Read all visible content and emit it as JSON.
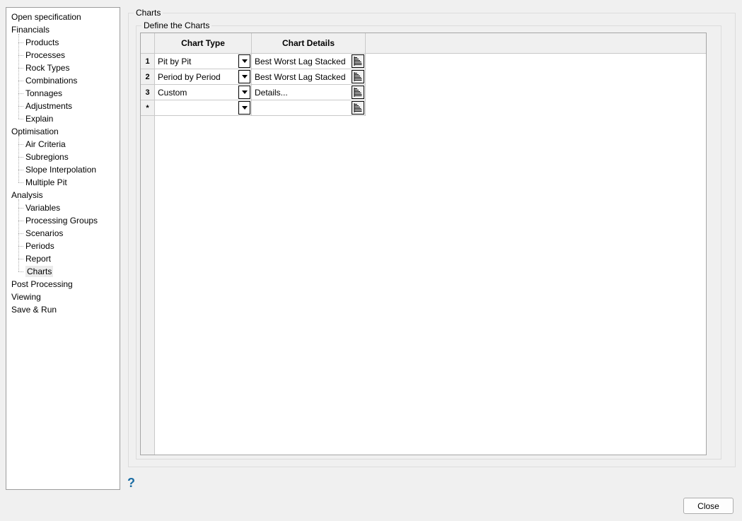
{
  "sidebar": {
    "selected": "Charts",
    "items": [
      {
        "label": "Open specification",
        "children": []
      },
      {
        "label": "Financials",
        "children": [
          "Products",
          "Processes",
          "Rock Types",
          "Combinations",
          "Tonnages",
          "Adjustments",
          "Explain"
        ]
      },
      {
        "label": "Optimisation",
        "children": [
          "Air Criteria",
          "Subregions",
          "Slope Interpolation",
          "Multiple Pit"
        ]
      },
      {
        "label": "Analysis",
        "children": [
          "Variables",
          "Processing Groups",
          "Scenarios",
          "Periods",
          "Report",
          "Charts"
        ]
      },
      {
        "label": "Post Processing",
        "children": []
      },
      {
        "label": "Viewing",
        "children": []
      },
      {
        "label": "Save & Run",
        "children": []
      }
    ]
  },
  "main": {
    "group_title": "Charts",
    "inner_group_title": "Define the Charts",
    "table": {
      "columns": [
        "",
        "Chart Type",
        "Chart Details"
      ],
      "rows": [
        {
          "num": "1",
          "chart_type": "Pit by Pit",
          "chart_details": "Best Worst Lag Stacked"
        },
        {
          "num": "2",
          "chart_type": "Period by Period",
          "chart_details": "Best Worst Lag Stacked"
        },
        {
          "num": "3",
          "chart_type": "Custom",
          "chart_details": "Details..."
        },
        {
          "num": "*",
          "chart_type": "",
          "chart_details": ""
        }
      ]
    }
  },
  "help": {
    "label": "?"
  },
  "footer": {
    "close_label": "Close"
  },
  "icons": {
    "dropdown-arrow-icon": "black down triangle",
    "chart-details-icon": "horizontal bar-lines glyph",
    "help-icon": "?"
  },
  "colors": {
    "window_background": "#f0f0f0",
    "help_accent": "#1a6ca3",
    "grid_header_background": "#f0f0f0",
    "selected_tree_item_background": "#ebebeb"
  }
}
